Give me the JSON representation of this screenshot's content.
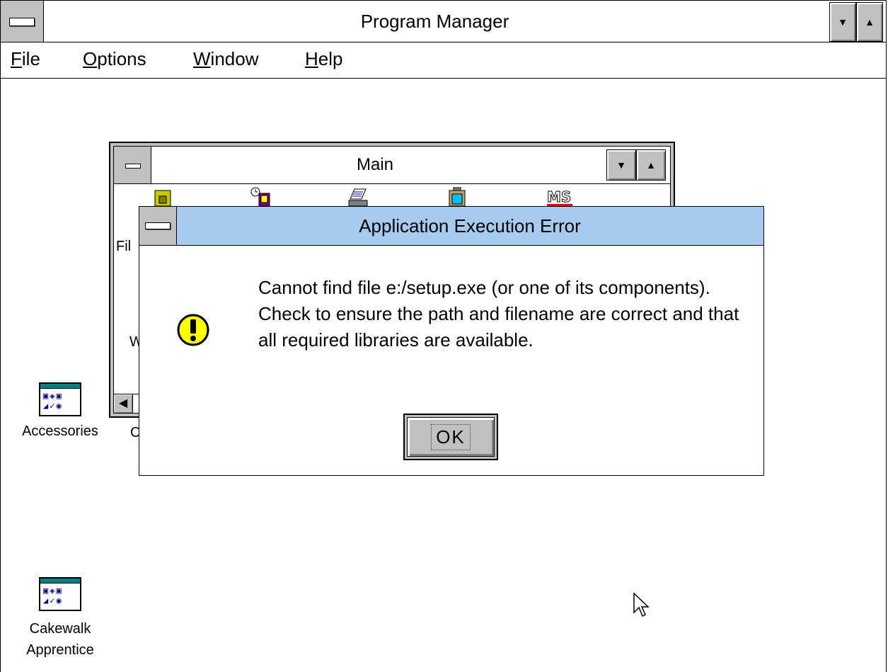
{
  "program_manager": {
    "title": "Program Manager",
    "menu": [
      {
        "label": "File",
        "accel": "F",
        "rest": "ile"
      },
      {
        "label": "Options",
        "accel": "O",
        "rest": "ptions"
      },
      {
        "label": "Window",
        "accel": "W",
        "rest": "indow"
      },
      {
        "label": "Help",
        "accel": "H",
        "rest": "elp"
      }
    ]
  },
  "main_window": {
    "title": "Main",
    "partial_labels": {
      "file": "Fil",
      "w": "W"
    },
    "icons": [
      "file-manager-icon",
      "clock-icon",
      "print-manager-icon",
      "clipboard-icon",
      "ms-dos-icon"
    ]
  },
  "dialog": {
    "title": "Application Execution Error",
    "message": "Cannot find file e:/setup.exe (or one of its components). Check to ensure the path and filename are correct and that all required libraries are available.",
    "ok_label": "OK",
    "icon": "exclamation-icon"
  },
  "desktop": {
    "accessories_label": "Accessories",
    "partial_c_label": "C",
    "cakewalk_label": "Cakewalk Apprentice"
  },
  "colors": {
    "dialog_title_bg": "#a6caf0",
    "chrome_gray": "#c0c0c0",
    "warning_yellow": "#ffff00"
  }
}
